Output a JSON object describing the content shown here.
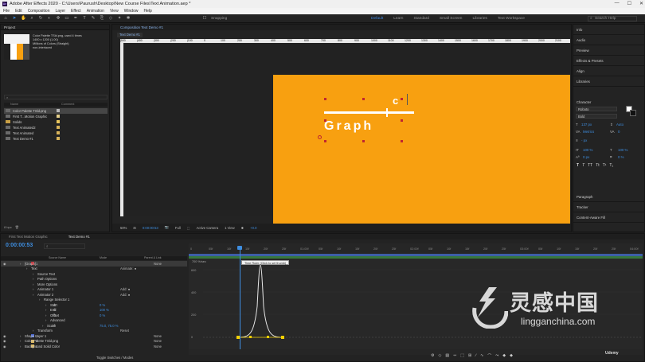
{
  "app": {
    "title": "Adobe After Effects 2020 - C:\\Users\\Paurush\\Desktop\\New Course Files\\Text Animation.aep *",
    "window_controls": [
      "—",
      "☐",
      "✕"
    ]
  },
  "menu": [
    "File",
    "Edit",
    "Composition",
    "Layer",
    "Effect",
    "Animation",
    "View",
    "Window",
    "Help"
  ],
  "toolbar": {
    "snapping_label": "Snapping",
    "workspaces": [
      "Default",
      "Learn",
      "Standard",
      "Small Screen",
      "Libraries",
      "Text Workspace"
    ],
    "active_workspace": "Default",
    "search_placeholder": "Search Help"
  },
  "project": {
    "tab": "Project",
    "item_name": "Color Palette TSld.png",
    "used": ", used 4 times",
    "info1": "1400 x 1200 (1.00)",
    "info2": "Millions of Colors (Straight)",
    "info3": "non-interlaced",
    "search_icon": "⌕",
    "col_name": "Name",
    "col_comment": "Comment",
    "items": [
      {
        "name": "Color Palette TSld.png",
        "color": "#b9b9b9",
        "selected": true
      },
      {
        "name": "First T...Motion Graphic",
        "color": "#e5d08a",
        "selected": false
      },
      {
        "name": "Solids",
        "color": "#e8c55c",
        "selected": false
      },
      {
        "name": "Text Animated2",
        "color": "#d9b45a",
        "selected": false
      },
      {
        "name": "Text Animated",
        "color": "#d9b45a",
        "selected": false
      },
      {
        "name": "Text Demo #1",
        "color": "#d9b45a",
        "selected": false
      }
    ],
    "footer": [
      "8 bpc",
      "🗑"
    ]
  },
  "composition": {
    "panel_tab": "Composition Text Demo #1",
    "sub_tab": "Text Demo #1",
    "ruler_ticks": [
      "|500",
      "|400",
      "|300",
      "|200",
      "|100",
      "0",
      "100",
      "200",
      "300",
      "400",
      "500",
      "600",
      "700",
      "800",
      "900",
      "1000",
      "1100",
      "1200",
      "1300",
      "1400",
      "1500",
      "1600",
      "1700",
      "1800",
      "1900",
      "2000",
      "2100",
      "2200"
    ],
    "text_c": "c",
    "text_graph": "Graph",
    "zoom": "50%",
    "time": "0:00:00:53",
    "resolution": "Full",
    "camera": "Active Camera",
    "views": "1 View",
    "exposure": "+0.0"
  },
  "right_panel": {
    "sections": [
      "Info",
      "Audio",
      "Preview",
      "Effects & Presets",
      "Align",
      "Libraries"
    ],
    "character": {
      "title": "Character",
      "font": "Roboto",
      "style": "Bold",
      "size": "137 px",
      "leading": "Auto",
      "kerning": "Metrics",
      "tracking": "0",
      "stroke": "- px",
      "vscale": "100 %",
      "hscale": "100 %",
      "baseline": "0 px",
      "tsume": "0 %",
      "style_icons": [
        "T",
        "T",
        "TT",
        "Tt",
        "T¹",
        "T₁"
      ]
    },
    "bottom_sections": [
      "Paragraph",
      "Tracker",
      "Content-Aware Fill"
    ]
  },
  "timeline": {
    "tabs": [
      "First Text Motion Graphic",
      "Text Demo #1"
    ],
    "active_tab": "Text Demo #1",
    "timecode": "0:00:00:53",
    "columns": [
      "Source Name",
      "Mode",
      "Parent & Link"
    ],
    "layers": [
      {
        "num": "1",
        "name": "[Graph]",
        "right": "None"
      },
      {
        "num": "",
        "name": "Text",
        "right": "Animate: ●"
      },
      {
        "num": "",
        "name": "Source Text",
        "right": ""
      },
      {
        "num": "",
        "name": "Path Options",
        "right": ""
      },
      {
        "num": "",
        "name": "More Options",
        "right": ""
      },
      {
        "num": "",
        "name": "Animator 1",
        "right": "Add: ●"
      },
      {
        "num": "",
        "name": "Animator 2",
        "right": "Add: ●"
      },
      {
        "num": "",
        "name": "Range Selector 1",
        "right": ""
      },
      {
        "num": "",
        "name": "Start",
        "value": "0 %"
      },
      {
        "num": "",
        "name": "End",
        "value": "100 %"
      },
      {
        "num": "",
        "name": "Offset",
        "value": "0 %"
      },
      {
        "num": "",
        "name": "Advanced",
        "right": ""
      },
      {
        "num": "",
        "name": "Scale",
        "value": "75.0, 75.0 %"
      },
      {
        "num": "",
        "name": "Transform",
        "right": "Reset"
      },
      {
        "num": "2",
        "name": "Shape Layer 1",
        "right": "None"
      },
      {
        "num": "3",
        "name": "Color Palette TSld.png",
        "right": "None"
      },
      {
        "num": "4",
        "name": "Background Solid Color",
        "right": "None"
      }
    ],
    "ruler": [
      "0",
      "05f",
      "10f",
      "15f",
      "20f",
      "25f",
      "01:00f",
      "05f",
      "10f",
      "15f",
      "20f",
      "25f",
      "02:00f",
      "05f",
      "10f",
      "15f",
      "20f",
      "25f",
      "03:00f",
      "05f",
      "10f",
      "15f",
      "20f",
      "25f",
      "04:00f"
    ],
    "graph_label": "700 %/sec",
    "y_labels": [
      "600",
      "400",
      "200",
      "0"
    ],
    "tooltip": "Time Ruler (Click to set thumb)",
    "toggle_label": "Toggle Switches / Modes",
    "graph_buttons": [
      "⚙",
      "◇",
      "▤",
      "⇿",
      "⬚",
      "⊞",
      "∕",
      "∿",
      "⌒",
      "⤳",
      "◆",
      "◆"
    ]
  },
  "watermark": {
    "cn": "灵感中国",
    "en": "lingganchina.com"
  },
  "branding": {
    "udemy": "Udemy"
  }
}
